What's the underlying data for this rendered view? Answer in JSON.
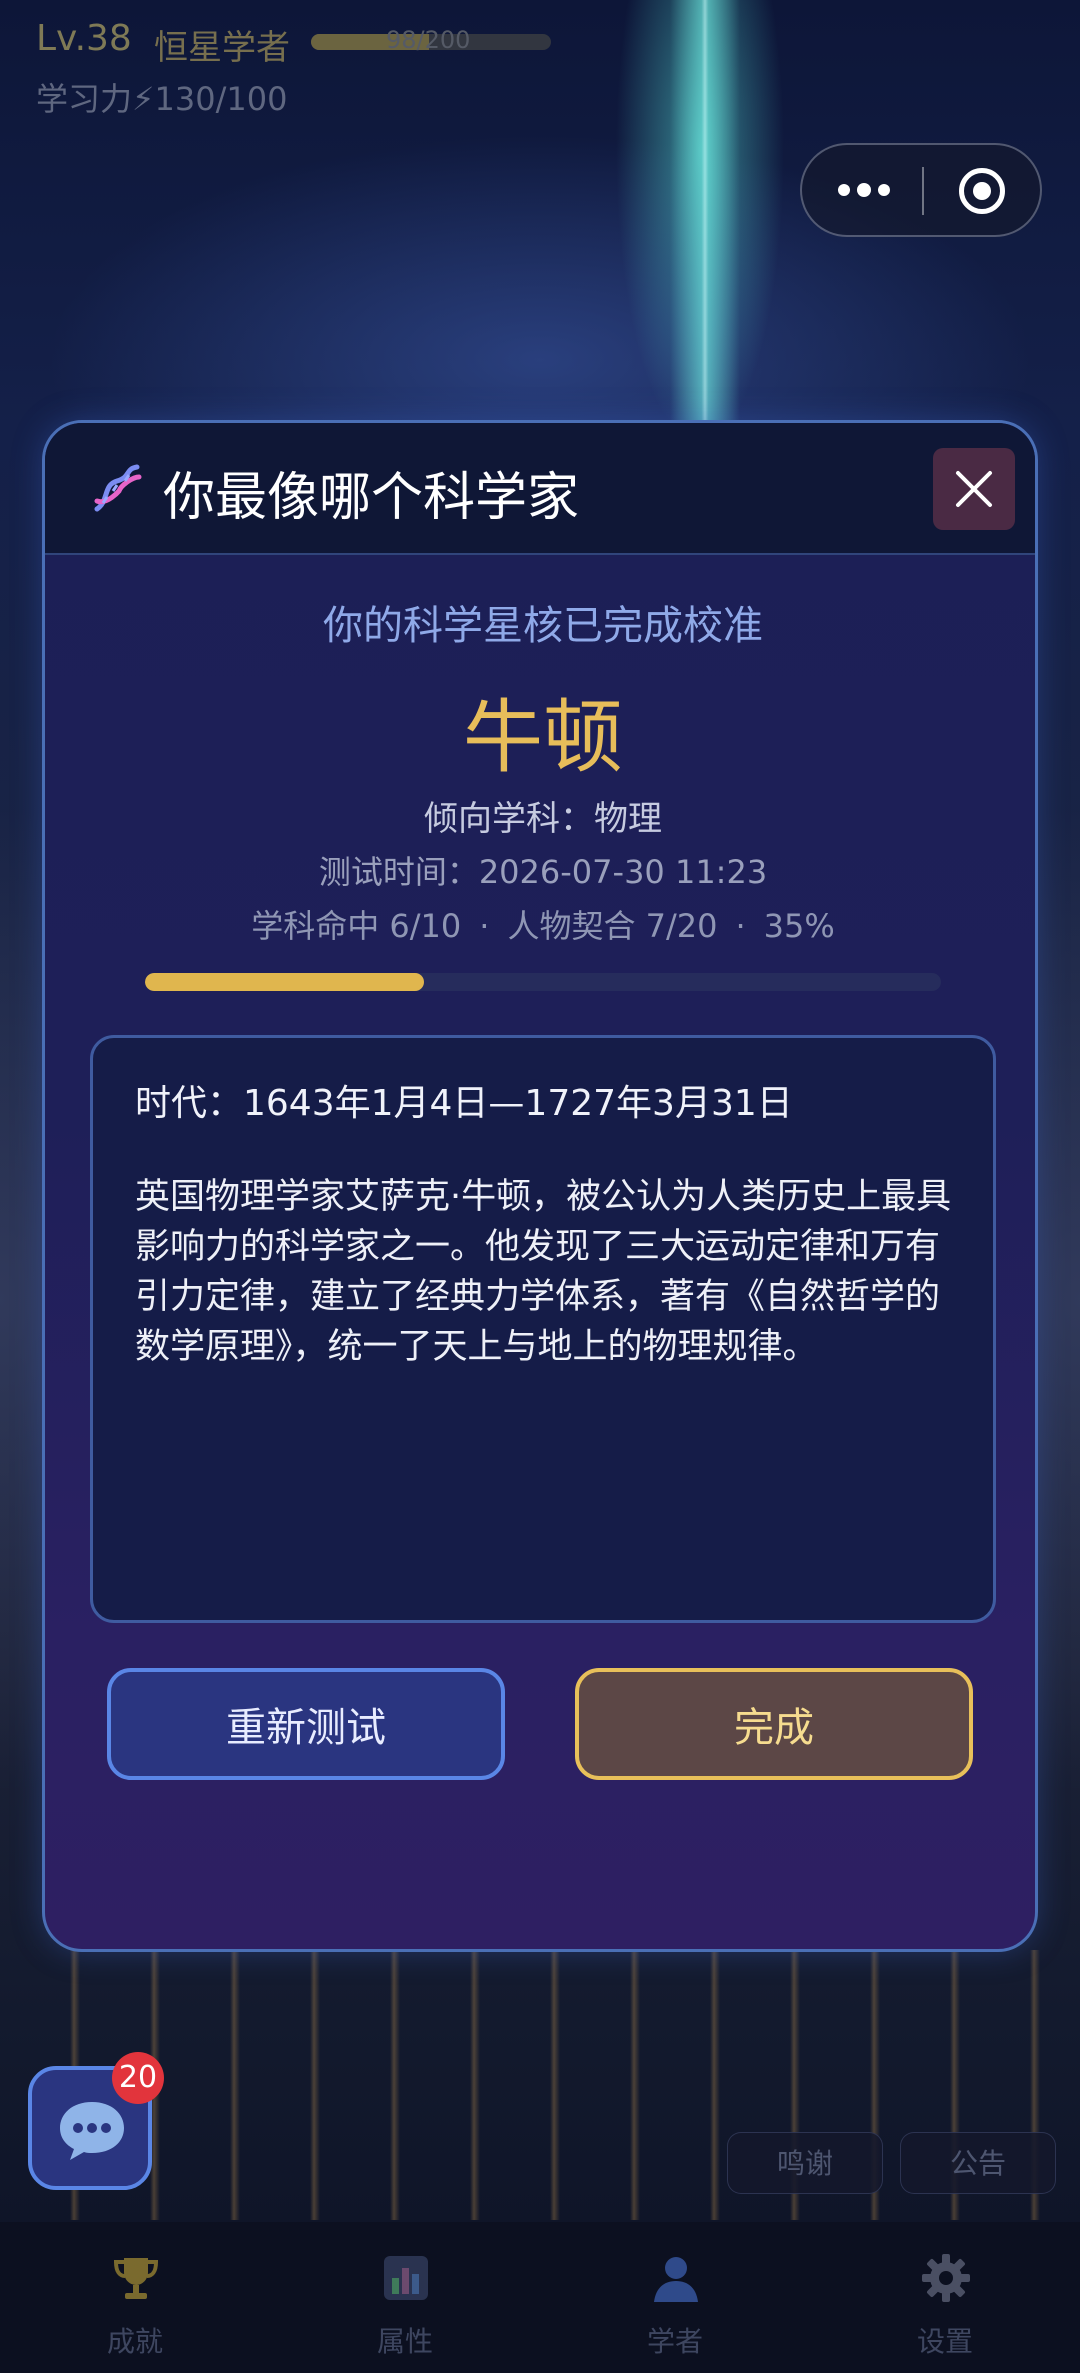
{
  "status": {
    "level": "Lv.38",
    "rank": "恒星学者",
    "xp_text": "98/200",
    "xp_progress": 0.49,
    "power_label": "学习力",
    "power_value": "130/100"
  },
  "modal": {
    "title": "你最像哪个科学家",
    "subtitle": "你的科学星核已完成校准",
    "scientist_name": "牛顿",
    "subject_label": "倾向学科：",
    "subject_value": "物理",
    "test_time": "测试时间：2026-07-30 11:23",
    "stats": {
      "subject_hit": "学科命中 6/10",
      "persona_match": "人物契合 7/20",
      "percent": "35%",
      "separator": "·"
    },
    "progress": 0.35,
    "era": "时代：1643年1月4日—1727年3月31日",
    "description": "英国物理学家艾萨克·牛顿，被公认为人类历史上最具影响力的科学家之一。他发现了三大运动定律和万有引力定律，建立了经典力学体系，著有《自然哲学的数学原理》，统一了天上与地上的物理规律。",
    "retry_label": "重新测试",
    "done_label": "完成"
  },
  "chat": {
    "badge_count": "20"
  },
  "pills": {
    "thanks": "鸣谢",
    "notice": "公告"
  },
  "tabs": [
    {
      "label": "成就",
      "icon": "trophy-icon",
      "color": "#7a6a2e"
    },
    {
      "label": "属性",
      "icon": "bar-chart-icon",
      "color": "#3c4a6e"
    },
    {
      "label": "学者",
      "icon": "person-icon",
      "color": "#2f4a8a"
    },
    {
      "label": "设置",
      "icon": "gear-icon",
      "color": "#4a4f63"
    }
  ],
  "colors": {
    "accent_gold": "#e0b64e",
    "accent_blue": "#5a86e6",
    "badge_red": "#e2343c"
  }
}
